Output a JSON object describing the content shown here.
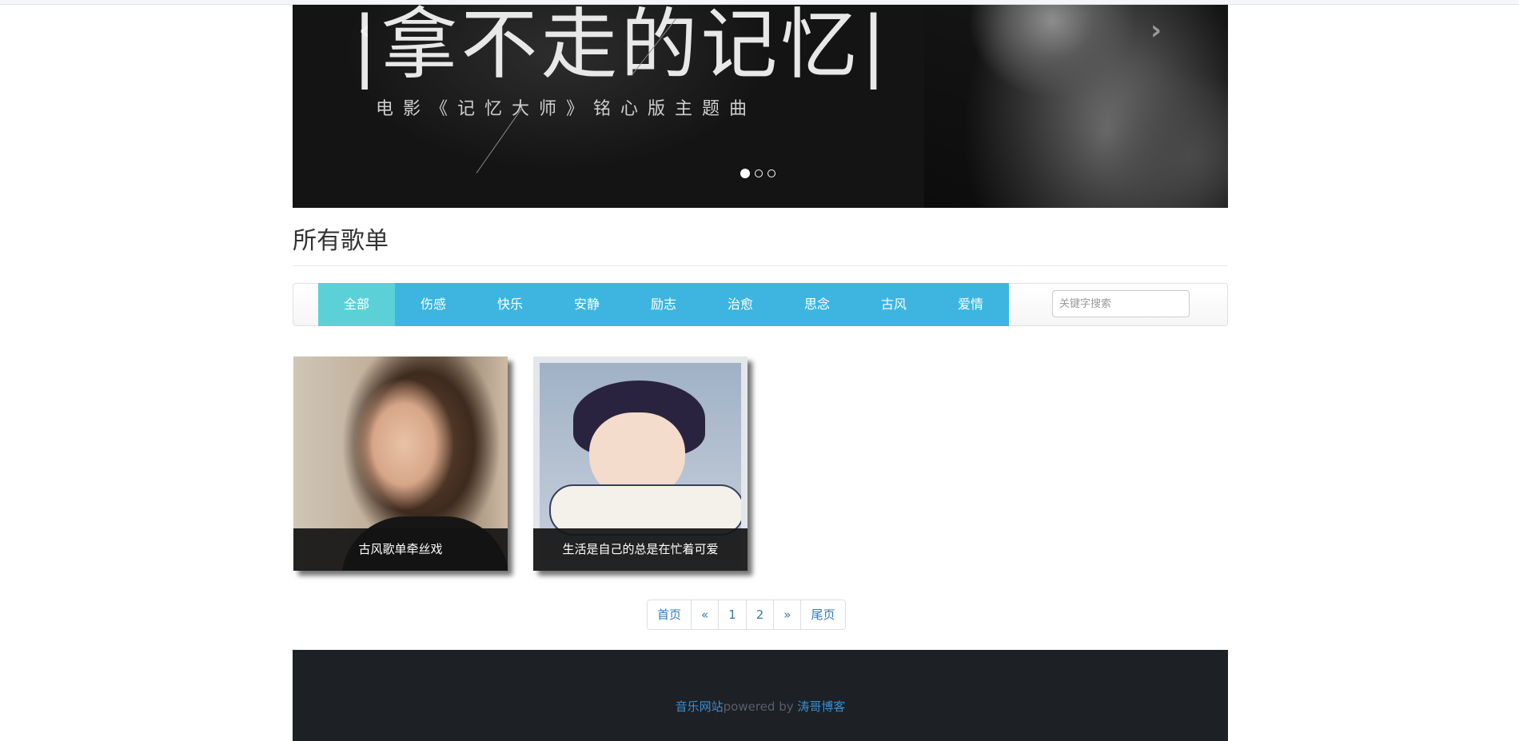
{
  "carousel": {
    "slide_title": "|拿不走的记忆|",
    "slide_subtitle": "电影《记忆大师》铭心版主题曲",
    "prev_icon": "‹",
    "next_icon": "›",
    "indicator_count": 3,
    "active_index": 0
  },
  "page": {
    "title": "所有歌单"
  },
  "categories": [
    "全部",
    "伤感",
    "快乐",
    "安静",
    "励志",
    "治愈",
    "思念",
    "古风",
    "爱情"
  ],
  "active_category": "全部",
  "search": {
    "placeholder": "关键字搜索",
    "value": ""
  },
  "playlists": [
    {
      "caption": "古风歌单牵丝戏"
    },
    {
      "caption": "生活是自己的总是在忙着可爱"
    }
  ],
  "pagination": {
    "first": "首页",
    "prev": "«",
    "pages": [
      "1",
      "2"
    ],
    "next": "»",
    "last": "尾页"
  },
  "footer": {
    "site_link": "音乐网站",
    "powered_text": "powered by ",
    "author_link": "涛哥博客"
  },
  "colors": {
    "category_bg": "#3db5e0",
    "category_active_bg": "#5bd1d7",
    "link": "#337ab7",
    "footer_bg": "#1d2024"
  }
}
